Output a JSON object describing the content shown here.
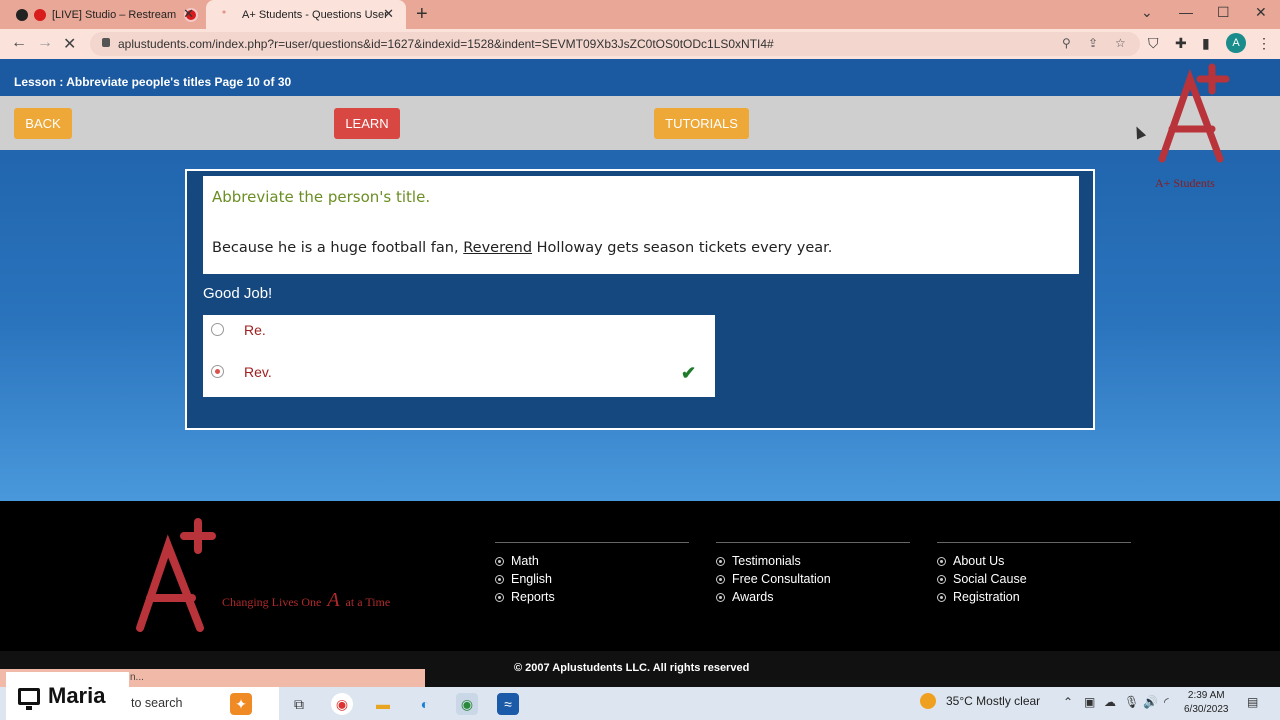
{
  "browser": {
    "tabs": [
      {
        "title": "[LIVE] Studio – Restream"
      },
      {
        "title": "A+ Students - Questions User"
      }
    ],
    "url": "aplustudents.com/index.php?r=user/questions&id=1627&indexid=1528&indent=SEVMT09Xb3JsZC0tOS0tODc1LS0xNTI4#",
    "profile_initial": "A"
  },
  "lesson": {
    "title": "Lesson : Abbreviate people's titles Page 10 of 30"
  },
  "toolbar": {
    "back_label": "BACK",
    "learn_label": "LEARN",
    "tutorials_label": "TUTORIALS"
  },
  "logo": {
    "caption": "A+ Students"
  },
  "question": {
    "instruction": "Abbreviate the person's title.",
    "sentence_before": "Because he is a huge football fan, ",
    "sentence_word": "Reverend",
    "sentence_after": " Holloway gets season tickets every year.",
    "feedback": "Good Job!",
    "answers": [
      {
        "label": "Re.",
        "selected": false,
        "correct": false
      },
      {
        "label": "Rev.",
        "selected": true,
        "correct": true
      }
    ]
  },
  "footer": {
    "tagline_before": "Changing Lives One",
    "tagline_letter": "A",
    "tagline_after": "at a Time",
    "columns": [
      [
        "Math",
        "English",
        "Reports"
      ],
      [
        "Testimonials",
        "Free Consultation",
        "Awards"
      ],
      [
        "About Us",
        "Social Cause",
        "Registration"
      ]
    ],
    "copyright": "© 2007 Aplustudents LLC. All rights reserved",
    "status_text": "n..."
  },
  "taskbar": {
    "user_name": "Maria",
    "search_placeholder": "to search",
    "weather": "35°C  Mostly clear",
    "time": "2:39 AM",
    "date": "6/30/2023"
  },
  "colors": {
    "brand_red": "#c0302e",
    "button_orange": "#eda838",
    "button_red": "#d84741",
    "correct_green": "#1f7a2c"
  }
}
